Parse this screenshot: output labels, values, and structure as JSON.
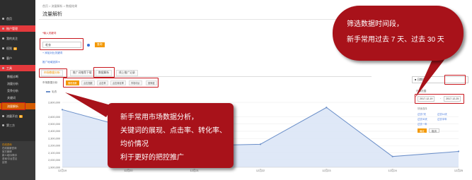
{
  "sidebar": {
    "items": [
      {
        "label": "首页",
        "icon": "home-icon"
      },
      {
        "label": "账户管理",
        "icon": "account-icon"
      },
      {
        "label": "我的关注",
        "icon": "star-icon"
      },
      {
        "label": "权限",
        "icon": "lock-icon",
        "badge": "新"
      },
      {
        "label": "客户",
        "icon": "user-icon"
      },
      {
        "label": "工具",
        "icon": "tool-icon"
      },
      {
        "label": "数据诊断",
        "icon": ""
      },
      {
        "label": "流量分析",
        "icon": ""
      },
      {
        "label": "竞争分析",
        "icon": ""
      },
      {
        "label": "关键词",
        "icon": ""
      },
      {
        "label": "流量解析",
        "icon": ""
      },
      {
        "label": "流量开启",
        "icon": "flow-icon",
        "badge": "新"
      },
      {
        "label": "第三方",
        "icon": "plug-icon"
      }
    ],
    "footer": {
      "title": "在线咨询",
      "lines": [
        "在线客服咨询",
        "官方微博",
        "新人培训/新手",
        "咨询/平台意见",
        "反馈"
      ]
    }
  },
  "header": {
    "breadcrumb": "首页 > 流量解析 > 数据结果",
    "title": "流量解析"
  },
  "form": {
    "field_label": "*输入关键词",
    "keyword_value": "毛衣",
    "action_label": "查询",
    "add_link": "+ 添加对比关键词",
    "region_link": "推广地域选择 ▾"
  },
  "tabs": [
    "市场数据分析",
    "推广词推荐下载",
    "数据解析",
    "线上推广记录"
  ],
  "sub_header": "市场数据分析",
  "subtabs": [
    "展现指数",
    "点击指数",
    "点击率",
    "点击转化率",
    "市场均价",
    "竞争度"
  ],
  "legend": "毛衣",
  "chart_data": {
    "type": "line",
    "y_ticks": [
      "2,800,000",
      "2,600,000",
      "2,500,000",
      "2,400,000",
      "2,300,000",
      "2,200,000",
      "2,100,000",
      "2,000,000",
      "1,900,000"
    ],
    "x": [
      "12月19",
      "12月20",
      "12月21",
      "12月22",
      "12月23",
      "12月24",
      "12月25"
    ],
    "series": [
      {
        "name": "毛衣",
        "values": [
          2700000,
          2450000,
          2200000,
          2220000,
          2730000,
          2050000,
          2120000
        ]
      }
    ],
    "ylim": [
      1900000,
      2850000
    ],
    "grid": true,
    "color": "#6b8fc9"
  },
  "date_panel": {
    "title": "日期范围",
    "start": "2017-12-19",
    "end": "2017-12-25",
    "quick_label": "快速选择",
    "options": [
      "过去7天",
      "过去14天",
      "过去30天",
      "过去半年",
      "过去一年"
    ],
    "ok": "确定",
    "cancel": "取消",
    "toggle": "■ 日期选择"
  },
  "callout_top": {
    "line1": "筛选数据时间段，",
    "line2": "新手常用过去 7 天、过去 30 天"
  },
  "callout_bottom": {
    "lines": [
      "新手常用市场数据分析，",
      "关键词的展现、点击率、转化率、",
      "均价情况",
      "利于更好的把控推广"
    ]
  }
}
